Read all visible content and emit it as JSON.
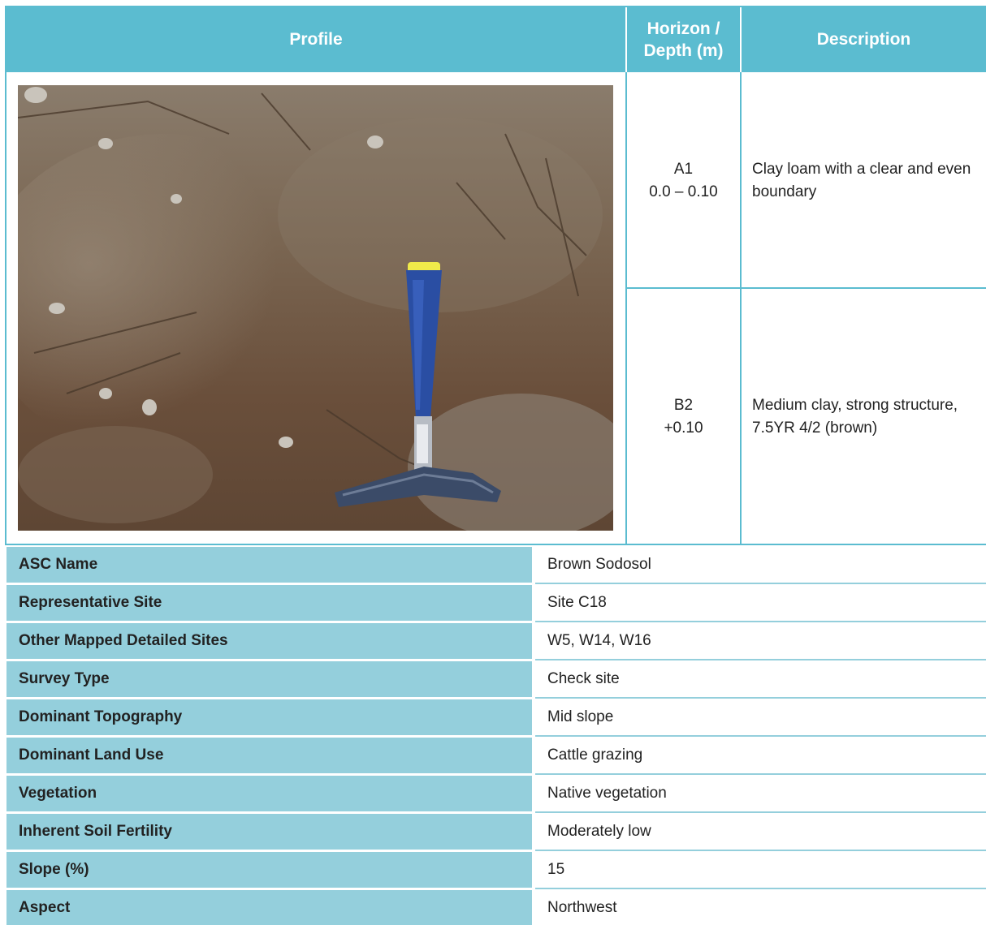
{
  "header": {
    "profile": "Profile",
    "horizon_line1": "Horizon /",
    "horizon_line2": "Depth (m)",
    "description": "Description"
  },
  "photo": {
    "subject": "soil-profile-photo-with-geological-hammer"
  },
  "horizons": [
    {
      "name": "A1",
      "depth": "0.0 – 0.10",
      "description": "Clay loam with a clear and even boundary"
    },
    {
      "name": "B2",
      "depth": "+0.10",
      "description": "Medium clay, strong structure, 7.5YR 4/2 (brown)"
    }
  ],
  "attributes": [
    {
      "label": "ASC Name",
      "value": "Brown Sodosol"
    },
    {
      "label": "Representative Site",
      "value": "Site C18"
    },
    {
      "label": "Other Mapped Detailed Sites",
      "value": "W5, W14, W16"
    },
    {
      "label": "Survey Type",
      "value": "Check site"
    },
    {
      "label": "Dominant Topography",
      "value": "Mid slope"
    },
    {
      "label": "Dominant Land Use",
      "value": "Cattle grazing"
    },
    {
      "label": "Vegetation",
      "value": "Native vegetation"
    },
    {
      "label": "Inherent Soil Fertility",
      "value": "Moderately low"
    },
    {
      "label": "Slope (%)",
      "value": "15"
    },
    {
      "label": "Aspect",
      "value": "Northwest"
    }
  ],
  "colors": {
    "header_bg": "#5bbcd0",
    "label_bg": "#94cfdc",
    "border": "#5bbcd0"
  }
}
